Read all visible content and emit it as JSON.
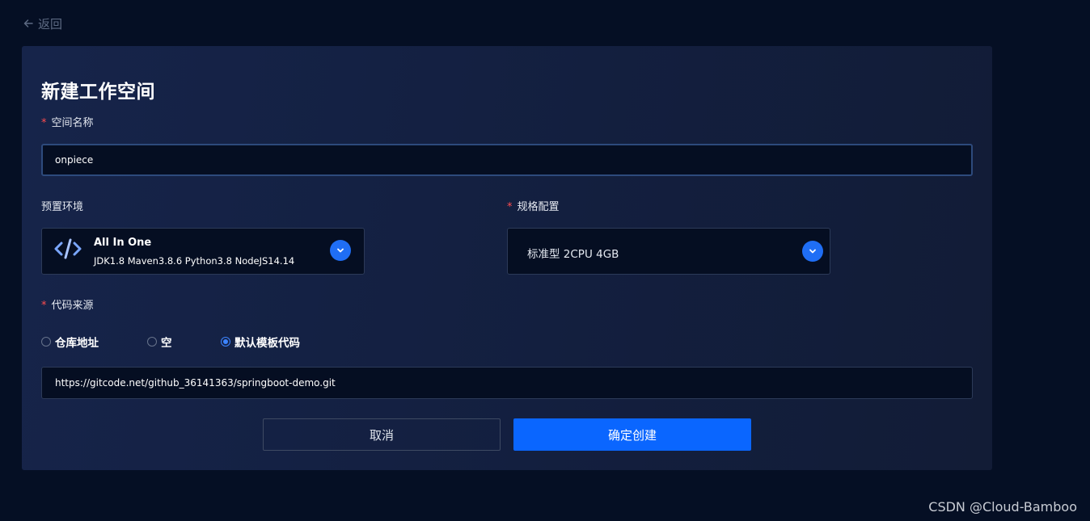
{
  "nav": {
    "back_label": "返回"
  },
  "form": {
    "title": "新建工作空间",
    "required_mark": "*",
    "name": {
      "label": "空间名称",
      "value": "onpiece"
    },
    "env": {
      "label": "预置环境",
      "selected_name": "All In One",
      "selected_desc": "JDK1.8 Maven3.8.6 Python3.8 NodeJS14.14",
      "icon": "code-icon"
    },
    "spec": {
      "label": "规格配置",
      "selected": "标准型 2CPU 4GB"
    },
    "source": {
      "label": "代码来源",
      "options": [
        {
          "label": "仓库地址",
          "selected": false
        },
        {
          "label": "空",
          "selected": false
        },
        {
          "label": "默认模板代码",
          "selected": true
        }
      ],
      "url": "https://gitcode.net/github_36141363/springboot-demo.git"
    },
    "cancel_label": "取消",
    "confirm_label": "确定创建"
  },
  "watermark": "CSDN @Cloud-Bamboo",
  "colors": {
    "background": "#050f24",
    "accent": "#0a66ff",
    "required": "#ff4d4f"
  }
}
